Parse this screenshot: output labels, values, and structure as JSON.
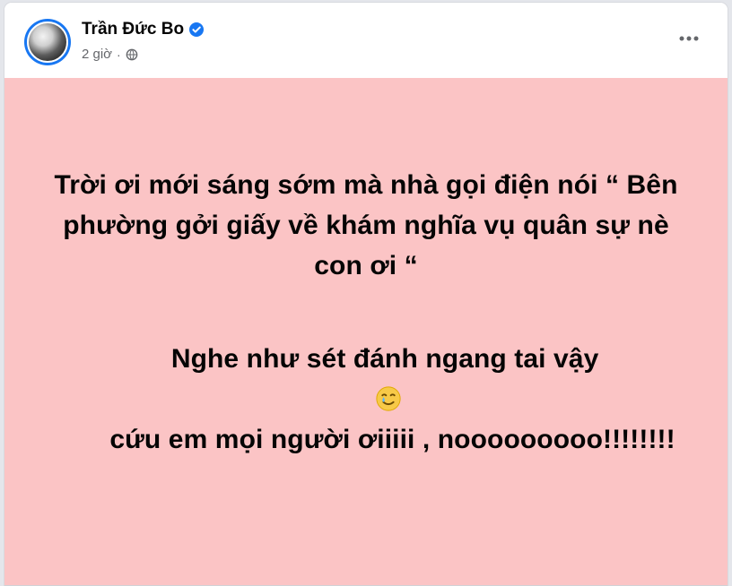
{
  "post": {
    "author_name": "Trần Đức Bo",
    "timestamp": "2 giờ",
    "separator": "·",
    "audience_icon": "globe-icon",
    "verified_icon": "verified-badge-icon",
    "more_icon": "more-options-icon",
    "avatar_icon": "profile-photo-avatar",
    "body": {
      "background_color": "#fbc4c5",
      "paragraph_1": "Trời ơi mới sáng sớm mà nhà gọi điện nói “ Bên phường gởi giấy về khám nghĩa vụ quân sự nè con ơi “",
      "paragraph_2_before_emoji": "Nghe như sét đánh ngang tai vậy ",
      "paragraph_2_emoji_icon": "crying-smile-emoji-icon",
      "paragraph_2_after_emoji": " cứu em mọi người ơiiiii , nooooooooo!!!!!!!!"
    }
  },
  "colors": {
    "verified_blue": "#1877f2",
    "meta_gray": "#65676b",
    "text_black": "#050505"
  }
}
